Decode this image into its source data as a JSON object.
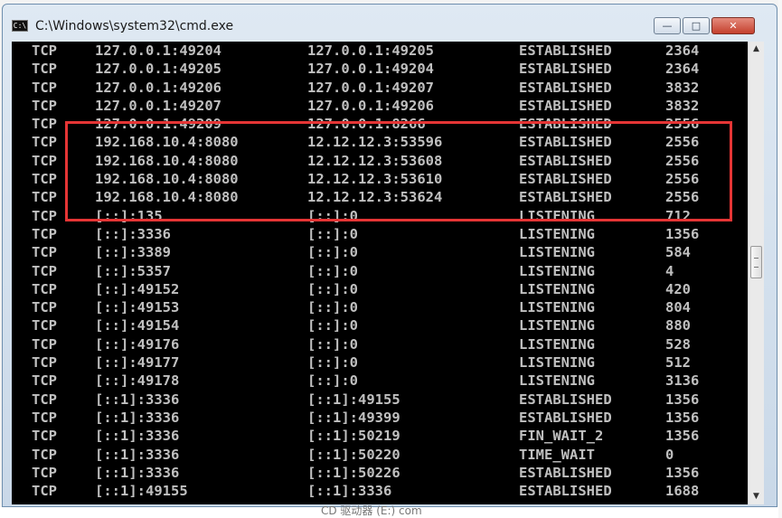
{
  "window": {
    "title": "C:\\Windows\\system32\\cmd.exe",
    "icon": "C:\\",
    "controls": {
      "minimize": "—",
      "maximize": "□",
      "close": "✕"
    }
  },
  "scrollbar": {
    "up": "▲",
    "down": "▼"
  },
  "highlight": {
    "color": "#e53535"
  },
  "bottom_strip": {
    "text": "CD 驱动器 (E:) com"
  },
  "netstat": {
    "rows": [
      [
        "TCP",
        "127.0.0.1:49204",
        "127.0.0.1:49205",
        "ESTABLISHED",
        "2364"
      ],
      [
        "TCP",
        "127.0.0.1:49205",
        "127.0.0.1:49204",
        "ESTABLISHED",
        "2364"
      ],
      [
        "TCP",
        "127.0.0.1:49206",
        "127.0.0.1:49207",
        "ESTABLISHED",
        "3832"
      ],
      [
        "TCP",
        "127.0.0.1:49207",
        "127.0.0.1:49206",
        "ESTABLISHED",
        "3832"
      ],
      [
        "TCP",
        "127.0.0.1:49209",
        "127.0.0.1:8266",
        "ESTABLISHED",
        "2556"
      ],
      [
        "TCP",
        "192.168.10.4:8080",
        "12.12.12.3:53596",
        "ESTABLISHED",
        "2556"
      ],
      [
        "TCP",
        "192.168.10.4:8080",
        "12.12.12.3:53608",
        "ESTABLISHED",
        "2556"
      ],
      [
        "TCP",
        "192.168.10.4:8080",
        "12.12.12.3:53610",
        "ESTABLISHED",
        "2556"
      ],
      [
        "TCP",
        "192.168.10.4:8080",
        "12.12.12.3:53624",
        "ESTABLISHED",
        "2556"
      ],
      [
        "TCP",
        "[::]:135",
        "[::]:0",
        "LISTENING",
        "712"
      ],
      [
        "TCP",
        "[::]:3336",
        "[::]:0",
        "LISTENING",
        "1356"
      ],
      [
        "TCP",
        "[::]:3389",
        "[::]:0",
        "LISTENING",
        "584"
      ],
      [
        "TCP",
        "[::]:5357",
        "[::]:0",
        "LISTENING",
        "4"
      ],
      [
        "TCP",
        "[::]:49152",
        "[::]:0",
        "LISTENING",
        "420"
      ],
      [
        "TCP",
        "[::]:49153",
        "[::]:0",
        "LISTENING",
        "804"
      ],
      [
        "TCP",
        "[::]:49154",
        "[::]:0",
        "LISTENING",
        "880"
      ],
      [
        "TCP",
        "[::]:49176",
        "[::]:0",
        "LISTENING",
        "528"
      ],
      [
        "TCP",
        "[::]:49177",
        "[::]:0",
        "LISTENING",
        "512"
      ],
      [
        "TCP",
        "[::]:49178",
        "[::]:0",
        "LISTENING",
        "3136"
      ],
      [
        "TCP",
        "[::1]:3336",
        "[::1]:49155",
        "ESTABLISHED",
        "1356"
      ],
      [
        "TCP",
        "[::1]:3336",
        "[::1]:49399",
        "ESTABLISHED",
        "1356"
      ],
      [
        "TCP",
        "[::1]:3336",
        "[::1]:50219",
        "FIN_WAIT_2",
        "1356"
      ],
      [
        "TCP",
        "[::1]:3336",
        "[::1]:50220",
        "TIME_WAIT",
        "0"
      ],
      [
        "TCP",
        "[::1]:3336",
        "[::1]:50226",
        "ESTABLISHED",
        "1356"
      ],
      [
        "TCP",
        "[::1]:49155",
        "[::1]:3336",
        "ESTABLISHED",
        "1688"
      ]
    ]
  }
}
